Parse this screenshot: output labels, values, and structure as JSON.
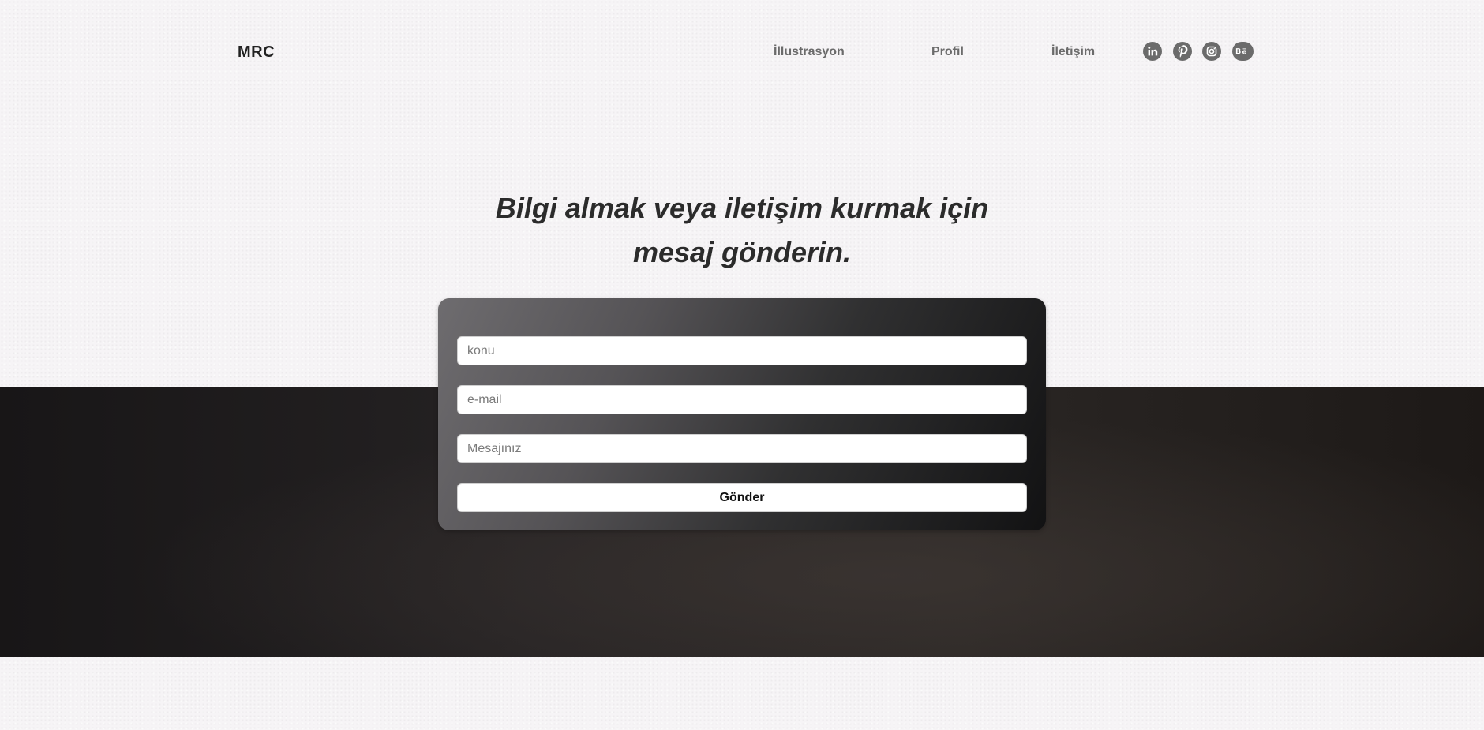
{
  "header": {
    "logo": "MRC",
    "nav": [
      {
        "label": "İllustrasyon"
      },
      {
        "label": "Profil"
      },
      {
        "label": "İletişim"
      }
    ],
    "social_icons": [
      "linkedin-icon",
      "pinterest-icon",
      "instagram-icon",
      "behance-icon"
    ]
  },
  "hero": {
    "heading_line1": "Bilgi almak veya iletişim kurmak için",
    "heading_line2": "mesaj gönderin."
  },
  "form": {
    "subject_placeholder": "konu",
    "email_placeholder": "e-mail",
    "message_placeholder": "Mesajınız",
    "submit_label": "Gönder"
  },
  "colors": {
    "page_background": "#f6f4f6",
    "dark_band": "#231f20",
    "nav_text": "#6b6b6b",
    "heading_text": "#2b2b2b"
  }
}
